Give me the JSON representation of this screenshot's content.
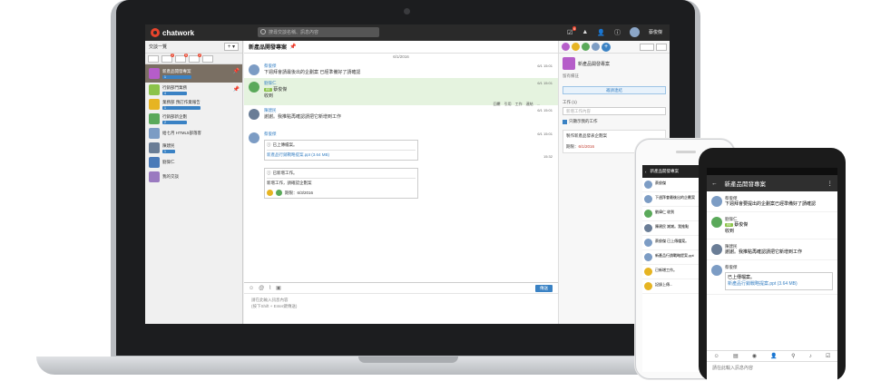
{
  "app": {
    "logo_text": "chatwork"
  },
  "topbar": {
    "search_placeholder": "搜尋交談名稱、訊息內容",
    "task_badge": "6",
    "username": "蔡俊傑"
  },
  "sidebar": {
    "title": "交談一覽",
    "add_label": "+ ▾",
    "filter_counts": [
      "2",
      "5",
      "2"
    ],
    "rooms": [
      {
        "name": "新產品開發專案",
        "count": "1",
        "color": "#b55dc9",
        "active": true
      },
      {
        "name": "行銷部門業務",
        "count": "4",
        "color": "#8bc34a"
      },
      {
        "name": "業務部 預訂作業報告",
        "count": "1",
        "color": "#e6b422"
      },
      {
        "name": "行銷部新企劃",
        "count": "2",
        "color": "#5aa95a"
      },
      {
        "name": "給七月 HTML5部落客",
        "count": "",
        "color": "#7c9cc4"
      },
      {
        "name": "陳建民",
        "count": "1",
        "color": "#6a7d96"
      },
      {
        "name": "劉偉仁",
        "count": "",
        "color": "#4a7ab8"
      },
      {
        "name": "我的交談",
        "count": "",
        "color": "#9a7ac0"
      }
    ]
  },
  "chat": {
    "title": "新產品開發專案",
    "date": "6/1/2016",
    "messages": [
      {
        "name": "蔡俊傑",
        "time": "6/1 15:01",
        "text": "下週拜會請最後出的企劃案 已經準備好了請確認"
      },
      {
        "name": "劉偉仁",
        "time": "6/1 15:01",
        "reply_to": "蔡俊傑",
        "text": "收到"
      },
      {
        "name": "陳建民",
        "time": "6/1 15:01",
        "text": "謝謝。我推點再確認請把它新增到工作"
      },
      {
        "name": "蔡俊傑",
        "time": "6/1 15:01",
        "file_title": "已上傳檔案。",
        "file_name": "新產品行銷戰略提案.ppt (3.64 MB)",
        "task_title": "已新增工作。",
        "task_text": "新增工作，請確認企劃案",
        "task_due": "期限：6/3/2016",
        "time2": "15:32"
      }
    ],
    "actions": [
      "回覆",
      "引用",
      "工作",
      "連結",
      "..."
    ],
    "composer": {
      "placeholder": "請在此輸入訊息內容\n(按下Shift + Enter鍵傳送)",
      "send_label": "傳送"
    }
  },
  "right_panel": {
    "room_name": "新產品開發專案",
    "sub": "留有備註",
    "action_btn": "邀請連結",
    "tasks_label": "工作 (1)",
    "task_placeholder": "新增工作內容",
    "checkbox_label": "只顯示我的工作",
    "task_text": "製作新產品發表企劃案",
    "task_due": "6/1/2016"
  },
  "iphone": {
    "title": "新產品開發專案",
    "rows": [
      "蔡俊傑",
      "下週拜會最後出的企劃案",
      "劉偉仁 收到",
      "陳建民 謝謝。我推點",
      "蔡俊傑 已上傳檔案。",
      "新產品行銷戰略提案.ppt",
      "已新增工作。",
      "記錄上傳..."
    ]
  },
  "android": {
    "title": "新產品開發專案",
    "messages": [
      {
        "name": "蔡俊傑",
        "text": "下週拜會要提出的企劃案已經準備好了請確認"
      },
      {
        "name": "劉偉仁",
        "reply": "蔡俊傑",
        "text": "收到"
      },
      {
        "name": "陳建民",
        "text": "謝謝。我推點再確認請把它新增到工作"
      },
      {
        "name": "蔡俊傑",
        "file_title": "已上傳檔案。",
        "file_name": "新產品行銷戰略提案.ppt (3.64 MB)"
      }
    ],
    "input_placeholder": "請在此輸入訊息內容"
  }
}
